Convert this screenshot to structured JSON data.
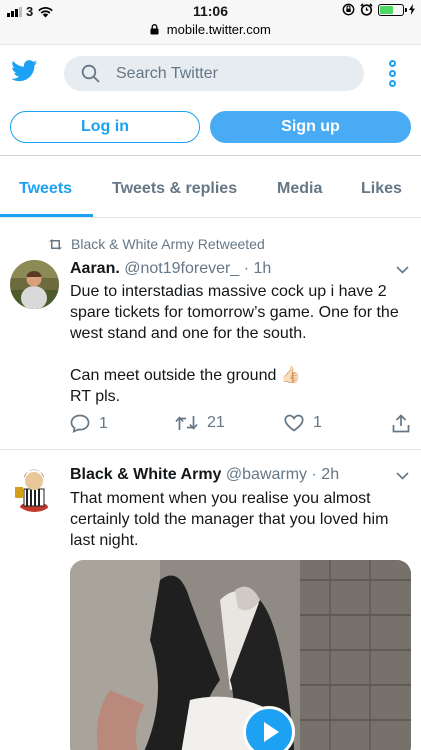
{
  "status_bar": {
    "carrier": "3",
    "time": "11:06"
  },
  "browser": {
    "url": "mobile.twitter.com"
  },
  "header": {
    "search_placeholder": "Search Twitter"
  },
  "auth": {
    "login_label": "Log in",
    "signup_label": "Sign up"
  },
  "tabs": [
    {
      "label": "Tweets",
      "active": true
    },
    {
      "label": "Tweets & replies",
      "active": false
    },
    {
      "label": "Media",
      "active": false
    },
    {
      "label": "Likes",
      "active": false
    }
  ],
  "tweets": [
    {
      "retweeted_by": "Black & White Army Retweeted",
      "name": "Aaran.",
      "handle": "@not19forever_",
      "time": "· 1h",
      "text": "Due to interstadias massive cock up i have 2 spare tickets for tomorrow’s game. One for the west stand and one for the south.\n\nCan meet outside the ground 👍🏻\nRT pls.",
      "replies": "1",
      "retweets": "21",
      "likes": "1"
    },
    {
      "name": "Black & White Army",
      "handle": "@bawarmy",
      "time": "· 2h",
      "text": "That moment when you realise you almost certainly told the manager that you loved him last night."
    }
  ],
  "colors": {
    "accent": "#1da1f2",
    "muted": "#657786",
    "divider": "#e1e8ed",
    "search_bg": "#e6ecf0"
  }
}
